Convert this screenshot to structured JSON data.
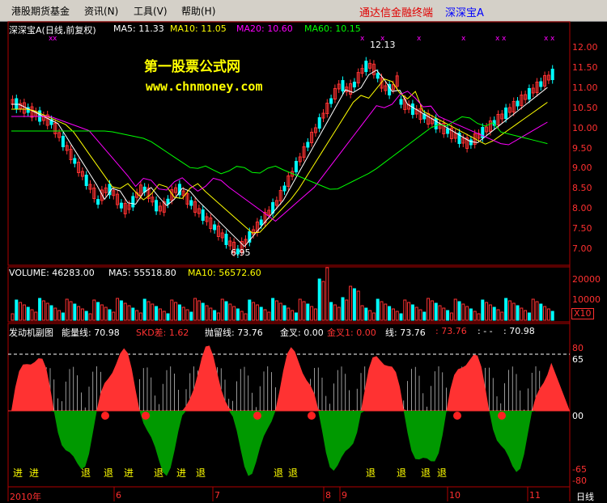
{
  "menu": {
    "items": [
      "港股期货基金",
      "资讯(N)",
      "工具(V)",
      "帮助(H)"
    ],
    "brand": "通达信金融终端",
    "stock": "深深宝A"
  },
  "main_panel": {
    "title": "深深宝A",
    "period": "(日线,前复权)",
    "ma": [
      {
        "label": "MA5: 11.33",
        "color": "#ffffff"
      },
      {
        "label": "MA10: 11.05",
        "color": "#ffff00"
      },
      {
        "label": "MA20: 10.60",
        "color": "#ff00ff"
      },
      {
        "label": "MA60: 10.15",
        "color": "#00ff00"
      }
    ],
    "watermark_line1": "第一股票公式网",
    "watermark_line2": "www.chnmoney.com",
    "high_label": "12.13",
    "low_label": "6.95",
    "y_ticks": [
      "12.00",
      "11.50",
      "11.00",
      "10.50",
      "10.00",
      "9.50",
      "9.00",
      "8.50",
      "8.00",
      "7.50",
      "7.00"
    ]
  },
  "volume_panel": {
    "label": "VOLUME: 46283.00",
    "ma5": "MA5: 55518.80",
    "ma10": "MA10: 56572.60",
    "y_ticks": [
      "20000",
      "10000"
    ],
    "unit": "X10"
  },
  "indicator_panel": {
    "name": "发动机副图",
    "energy": "能量线: 70.98",
    "skd": "SKD差: 1.62",
    "throw": "抛留线: 73.76",
    "gold": "金叉: 0.00",
    "gold1": "金叉1: 0.00",
    "line": "线: 73.76",
    "v1": ": 73.76",
    "v2": ": - -",
    "v3": ": 70.98",
    "y_ticks": [
      "80",
      "65",
      "00",
      "-65",
      "-80"
    ],
    "signals_in": [
      "进",
      "进",
      "进",
      "进"
    ],
    "signals_out": [
      "退",
      "退",
      "退",
      "退",
      "退",
      "退",
      "退",
      "退",
      "退",
      "退"
    ]
  },
  "x_axis": {
    "labels": [
      "2010年",
      "6",
      "7",
      "8",
      "9",
      "10",
      "11"
    ],
    "period_button": "日线"
  },
  "colors": {
    "up": "#ff3232",
    "down": "#00ffff",
    "ma5": "#ffffff",
    "ma10": "#ffff00",
    "ma20": "#ff00ff",
    "ma60": "#00ff00",
    "axis": "#b00000",
    "watermark": "#ffff00"
  }
}
